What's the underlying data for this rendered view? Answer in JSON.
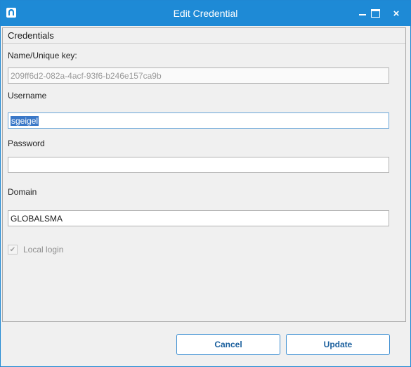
{
  "window": {
    "title": "Edit Credential",
    "accent_color": "#1e8ad6",
    "controls": [
      "minimize-icon",
      "maximize-icon",
      "close-icon"
    ],
    "close_glyph": "×"
  },
  "section": {
    "title": "Credentials"
  },
  "fields": {
    "name_key": {
      "label": "Name/Unique key:",
      "value": "209ff6d2-082a-4acf-93f6-b246e157ca9b"
    },
    "username": {
      "label": "Username",
      "value": "sgeigel"
    },
    "password": {
      "label": "Password",
      "value": ""
    },
    "domain": {
      "label": "Domain",
      "value": "GLOBALSMA"
    }
  },
  "local_login": {
    "label": "Local login",
    "checked": true,
    "check_glyph": "✔"
  },
  "buttons": {
    "cancel": "Cancel",
    "update": "Update"
  }
}
